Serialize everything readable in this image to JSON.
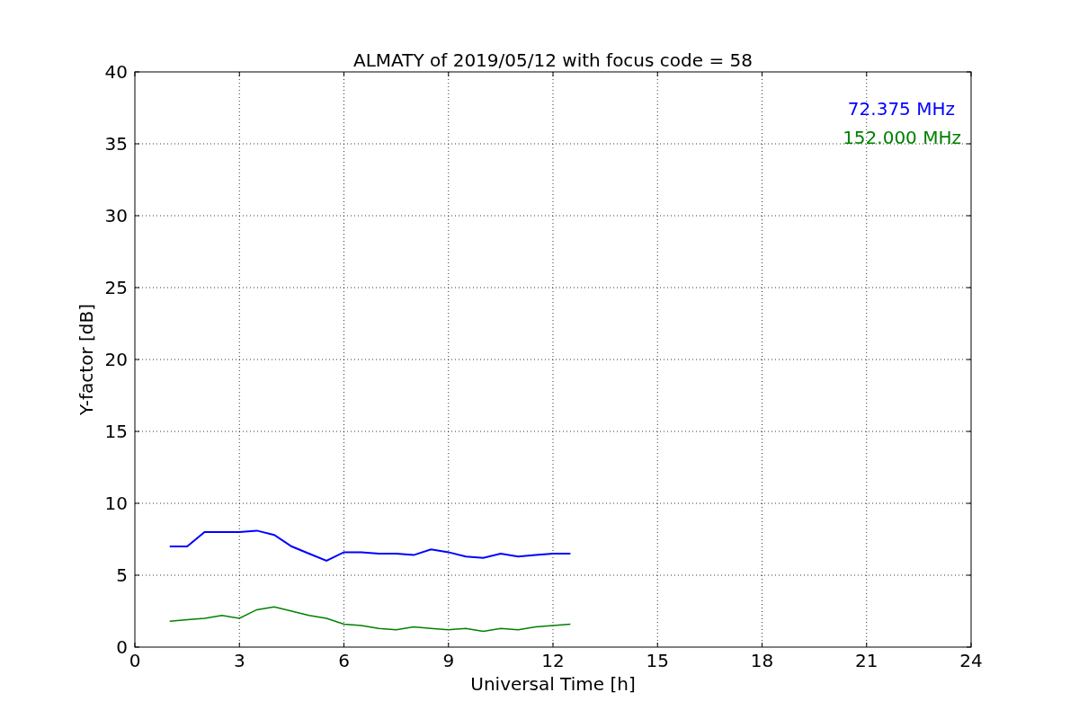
{
  "figure": {
    "chart_data": {
      "type": "line",
      "title": "ALMATY of 2019/05/12 with focus code = 58",
      "xlabel": "Universal Time [h]",
      "ylabel": "Y-factor [dB]",
      "x": [
        1,
        1.5,
        2,
        2.5,
        3,
        3.5,
        4,
        4.5,
        5,
        5.5,
        6,
        6.5,
        7,
        7.5,
        8,
        8.5,
        9,
        9.5,
        10,
        10.5,
        11,
        11.5,
        12,
        12.5
      ],
      "series": [
        {
          "name": "72.375 MHz",
          "color": "#0000ff",
          "values": [
            7.0,
            7.0,
            8.0,
            8.0,
            8.0,
            8.1,
            7.8,
            7.0,
            6.5,
            6.0,
            6.6,
            6.6,
            6.5,
            6.5,
            6.4,
            6.8,
            6.6,
            6.3,
            6.2,
            6.5,
            6.3,
            6.4,
            6.5,
            6.5
          ]
        },
        {
          "name": "152.000 MHz",
          "color": "#008000",
          "values": [
            1.8,
            1.9,
            2.0,
            2.2,
            2.0,
            2.6,
            2.8,
            2.5,
            2.2,
            2.0,
            1.6,
            1.5,
            1.3,
            1.2,
            1.4,
            1.3,
            1.2,
            1.3,
            1.1,
            1.3,
            1.2,
            1.4,
            1.5,
            1.6
          ]
        }
      ],
      "grid": true,
      "xlim": [
        0,
        24
      ],
      "ylim": [
        0,
        40
      ],
      "xticks": [
        0,
        3,
        6,
        9,
        12,
        15,
        18,
        21,
        24
      ],
      "yticks": [
        0,
        5,
        10,
        15,
        20,
        25,
        30,
        35,
        40
      ]
    }
  }
}
